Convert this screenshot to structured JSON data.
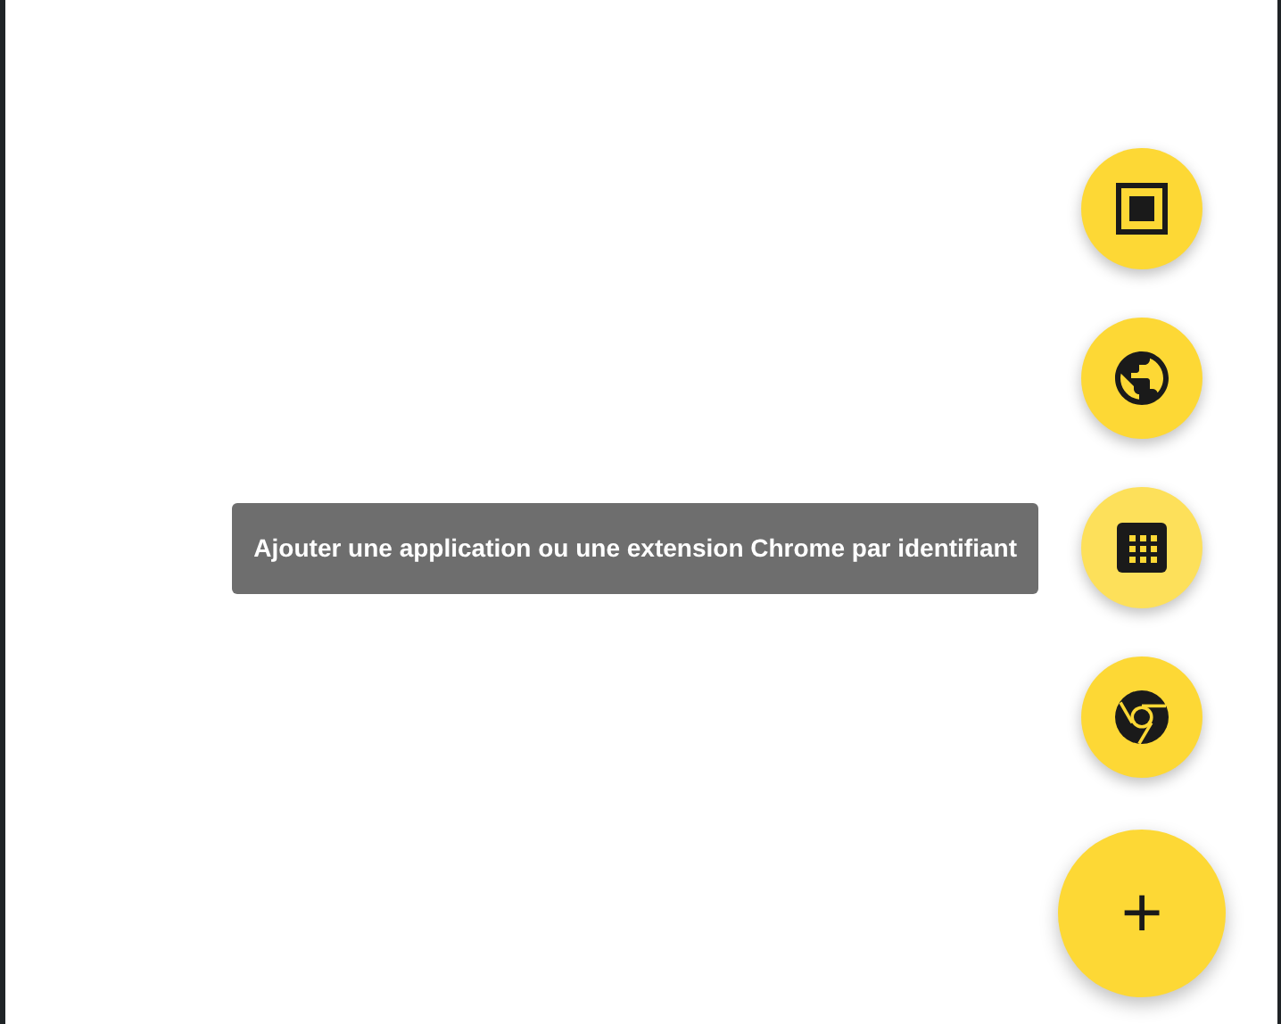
{
  "speed_dial": {
    "actions": [
      {
        "kind": "kiosk",
        "hovered": false
      },
      {
        "kind": "web",
        "hovered": false
      },
      {
        "kind": "app-id",
        "hovered": true,
        "tooltip": "Ajouter une application ou une extension Chrome par identifiant"
      },
      {
        "kind": "chrome",
        "hovered": false
      }
    ],
    "main_button": "+"
  }
}
